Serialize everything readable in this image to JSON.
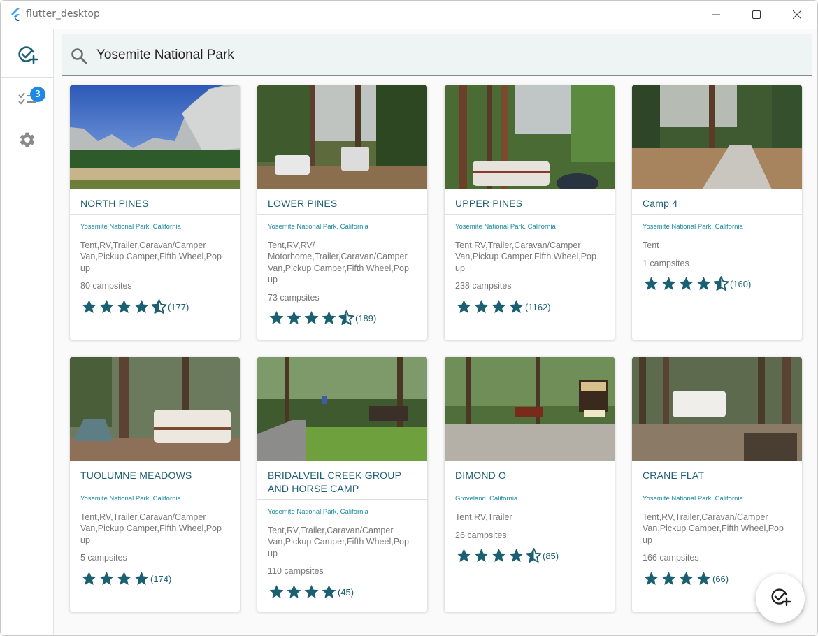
{
  "window": {
    "title": "flutter_desktop"
  },
  "rail": {
    "badge_count": "3"
  },
  "search": {
    "value": "Yosemite National Park"
  },
  "colors": {
    "accent": "#1d5f73",
    "star": "#1a5f72",
    "location": "#188a9e",
    "badge": "#1e88e5"
  },
  "cards": [
    {
      "title": "NORTH PINES",
      "location": "Yosemite National Park, California",
      "types": "Tent,RV,Trailer,Caravan/Camper Van,Pickup Camper,Fifth Wheel,Pop up",
      "campsites": "80 campsites",
      "rating": 4.5,
      "reviews": "(177)"
    },
    {
      "title": "LOWER PINES",
      "location": "Yosemite National Park, California",
      "types": "Tent,RV,RV/ Motorhome,Trailer,Caravan/Camper Van,Pickup Camper,Fifth Wheel,Pop up",
      "campsites": "73 campsites",
      "rating": 4.5,
      "reviews": "(189)"
    },
    {
      "title": "UPPER PINES",
      "location": "Yosemite National Park, California",
      "types": "Tent,RV,Trailer,Caravan/Camper Van,Pickup Camper,Fifth Wheel,Pop up",
      "campsites": "238 campsites",
      "rating": 4,
      "reviews": "(1162)"
    },
    {
      "title": "Camp 4",
      "location": "Yosemite National Park, California",
      "types": "Tent",
      "campsites": "1 campsites",
      "rating": 4.5,
      "reviews": "(160)"
    },
    {
      "title": "TUOLUMNE MEADOWS",
      "location": "Yosemite National Park, California",
      "types": "Tent,RV,Trailer,Caravan/Camper Van,Pickup Camper,Fifth Wheel,Pop up",
      "campsites": "5 campsites",
      "rating": 4,
      "reviews": "(174)"
    },
    {
      "title": "BRIDALVEIL CREEK GROUP AND HORSE CAMP",
      "location": "Yosemite National Park, California",
      "types": "Tent,RV,Trailer,Caravan/Camper Van,Pickup Camper,Fifth Wheel,Pop up",
      "campsites": "110 campsites",
      "rating": 4,
      "reviews": "(45)"
    },
    {
      "title": "DIMOND O",
      "location": "Groveland, California",
      "types": "Tent,RV,Trailer",
      "campsites": "26 campsites",
      "rating": 4.5,
      "reviews": "(85)"
    },
    {
      "title": "CRANE FLAT",
      "location": "Yosemite National Park, California",
      "types": "Tent,RV,Trailer,Caravan/Camper Van,Pickup Camper,Fifth Wheel,Pop up",
      "campsites": "166 campsites",
      "rating": 4,
      "reviews": "(66)"
    }
  ]
}
